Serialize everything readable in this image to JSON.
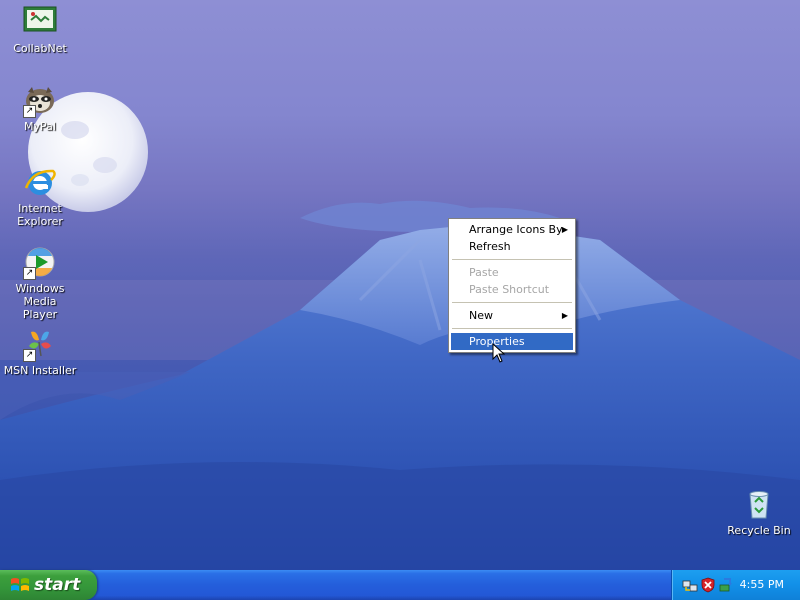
{
  "desktop_icons": [
    {
      "label": "CollabNet",
      "icon": "collabnet-icon"
    },
    {
      "label": "MyPal",
      "icon": "mypal-icon"
    },
    {
      "label": "Internet\nExplorer",
      "icon": "internet-explorer-icon"
    },
    {
      "label": "Windows Media\nPlayer",
      "icon": "windows-media-player-icon"
    },
    {
      "label": "MSN Installer",
      "icon": "msn-installer-icon"
    },
    {
      "label": "Recycle Bin",
      "icon": "recycle-bin-icon"
    }
  ],
  "context_menu": {
    "arrange_icons_by": "Arrange Icons By",
    "refresh": "Refresh",
    "paste": "Paste",
    "paste_shortcut": "Paste Shortcut",
    "new": "New",
    "properties": "Properties",
    "submenu_arrow": "▶"
  },
  "taskbar": {
    "start_label": "start",
    "clock": "4:55 PM",
    "tray_icons": [
      "network-icon",
      "security-shield-icon",
      "update-icon"
    ]
  },
  "colors": {
    "taskbar": "#245edb",
    "start_button": "#3c9f3c",
    "menu_highlight": "#316ac5"
  }
}
